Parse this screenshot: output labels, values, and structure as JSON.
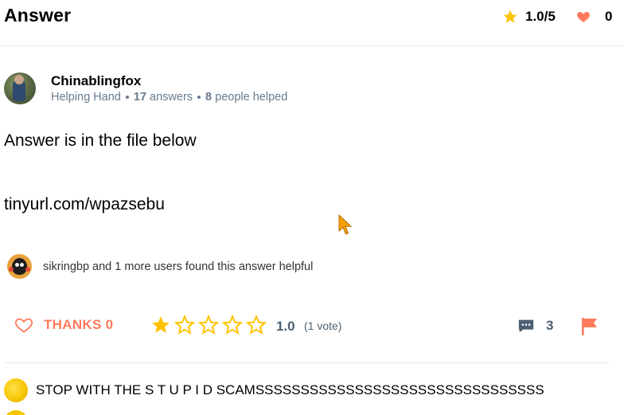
{
  "header": {
    "title": "Answer",
    "rating": "1.0/5",
    "likes": "0"
  },
  "author": {
    "name": "Chinablingfox",
    "rank": "Helping Hand",
    "answers_count": "17",
    "answers_label": "answers",
    "helped_count": "8",
    "helped_label": "people helped"
  },
  "answer": {
    "line1": "Answer is in the file below",
    "line2": "tinyurl.com/wpazsebu"
  },
  "helpful": {
    "text": "sikringbp and 1 more users found this answer helpful"
  },
  "actions": {
    "thanks_label": "THANKS 0",
    "rating_value": "1.0",
    "votes": "(1 vote)",
    "comments_count": "3",
    "stars_filled": 1,
    "stars_total": 5
  },
  "colors": {
    "star": "#ffc300",
    "heart": "#ff7a5c",
    "flag": "#ff7a5c",
    "muted": "#687b8c",
    "divider": "#e6e9ec"
  },
  "comments": [
    {
      "text": "STOP WITH THE S T U P I D SCAMSSSSSSSSSSSSSSSSSSSSSSSSSSSSSSSS"
    }
  ]
}
